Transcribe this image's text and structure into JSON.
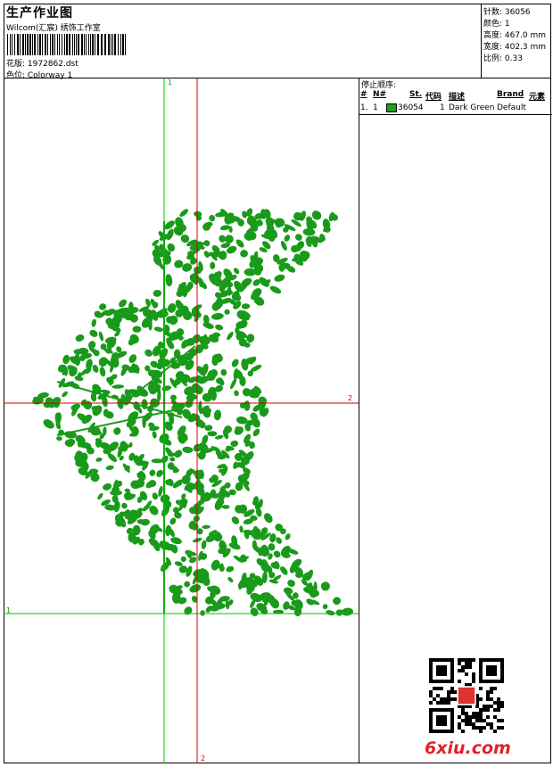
{
  "header": {
    "title": "生产作业图",
    "studio": "Wilcom(汇宸) 绣饰工作室",
    "design": "花版: 1972862.dst",
    "colorway": "色位: Colorway 1"
  },
  "stats": {
    "stitches": "针数: 36056",
    "colors": "颜色: 1",
    "height": "高度: 467.0 mm",
    "width": "宽度: 402.3 mm",
    "scale": "比例: 0.33"
  },
  "stop_sequence": {
    "title": "停止顺序:",
    "headers": [
      "#",
      "N#",
      "St.",
      "代码",
      "描述",
      "Brand",
      "元素"
    ],
    "row": {
      "index": "1.",
      "needle": "1",
      "stitches": "36054",
      "code": "1",
      "description": "Dark Green",
      "brand": "Default"
    },
    "swatch_color": "#1aa11a"
  },
  "guides": {
    "green_label_top": "1",
    "green_label_left": "1",
    "red_label_right": "2",
    "red_label_bottom": "2"
  },
  "watermark": "6xiu.com",
  "colors": {
    "embroidery": "#1a9a1a",
    "guide_green": "#00c000",
    "guide_red": "#d00000"
  }
}
